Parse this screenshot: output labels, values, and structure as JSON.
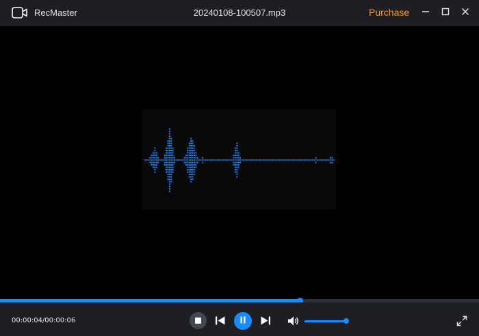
{
  "window": {
    "app_name": "RecMaster",
    "file_name": "20240108-100507.mp3",
    "purchase_label": "Purchase"
  },
  "playback": {
    "time_display": "00:00:04/00:00:06",
    "progress_fraction": 0.625,
    "volume_fraction": 1.0,
    "state": "playing"
  },
  "icons": {
    "app": "camera-icon",
    "minimize": "minimize-icon",
    "maximize": "maximize-icon",
    "close": "close-icon",
    "stop": "stop-icon",
    "previous": "skip-previous-icon",
    "pause": "pause-icon",
    "next": "skip-next-icon",
    "volume": "volume-icon",
    "fullscreen": "fullscreen-icon"
  },
  "colors": {
    "accent": "#1a8cff",
    "purchase": "#ff9a1f",
    "titlebar": "#1e1f24",
    "waveform": "#1a8cff"
  },
  "waveform_levels": [
    1,
    1,
    1,
    2,
    3,
    4,
    6,
    4,
    2,
    1,
    1,
    1,
    3,
    6,
    9,
    14,
    10,
    6,
    2,
    1,
    1,
    1,
    1,
    1,
    2,
    3,
    6,
    8,
    10,
    9,
    7,
    4,
    2,
    1,
    1,
    2,
    1,
    1,
    1,
    1,
    1,
    1,
    1,
    1,
    1,
    1,
    1,
    1,
    1,
    1,
    1,
    1,
    1,
    1,
    3,
    6,
    8,
    4,
    2,
    1,
    1,
    1,
    1,
    1,
    1,
    1,
    1,
    1,
    1,
    1,
    1,
    1,
    1,
    1,
    1,
    1,
    1,
    1,
    1,
    1,
    1,
    1,
    1,
    1,
    1,
    1,
    1,
    1,
    1,
    1,
    1,
    1,
    1,
    1,
    1,
    1,
    1,
    1,
    1,
    1,
    1,
    1,
    1,
    1,
    2,
    1,
    1,
    1,
    1,
    1,
    1,
    1,
    1,
    2,
    2,
    1
  ]
}
